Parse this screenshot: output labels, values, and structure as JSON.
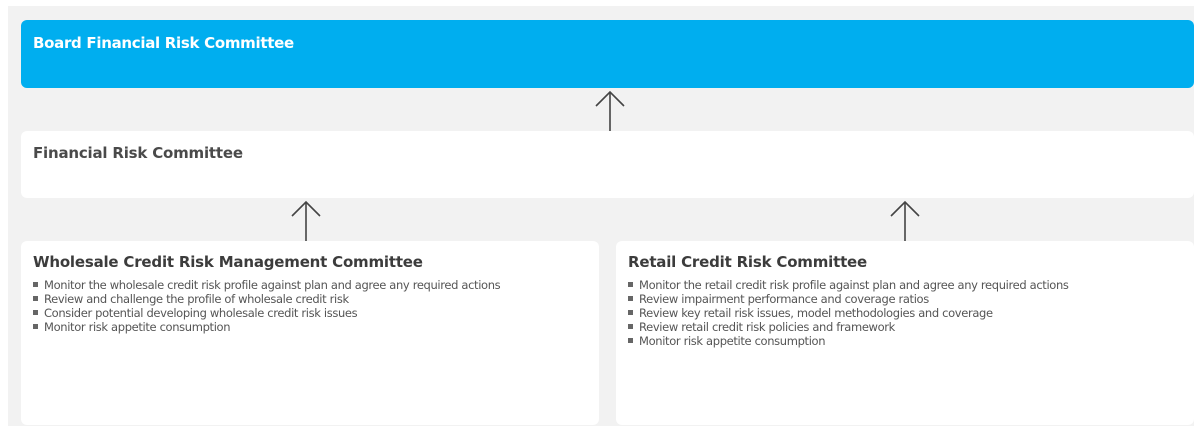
{
  "board": {
    "title": "Board Financial Risk Committee"
  },
  "financial_risk_committee": {
    "title": "Financial Risk Committee"
  },
  "wholesale": {
    "title": "Wholesale Credit Risk Management Committee",
    "items": [
      "Monitor the wholesale credit risk profile against plan and agree any required actions",
      "Review and challenge the profile of wholesale credit risk",
      "Consider potential developing wholesale credit risk issues",
      "Monitor risk appetite consumption"
    ]
  },
  "retail": {
    "title": "Retail Credit Risk Committee",
    "items": [
      "Monitor the retail credit risk profile against plan and agree any required actions",
      "Review impairment performance and coverage ratios",
      "Review key retail risk issues, model methodologies and coverage",
      "Review retail credit risk policies and framework",
      "Monitor risk appetite consumption"
    ]
  },
  "colors": {
    "board_fill": "#00aeef",
    "canvas": "#f2f2f2",
    "box": "#ffffff",
    "arrow": "#444444"
  }
}
